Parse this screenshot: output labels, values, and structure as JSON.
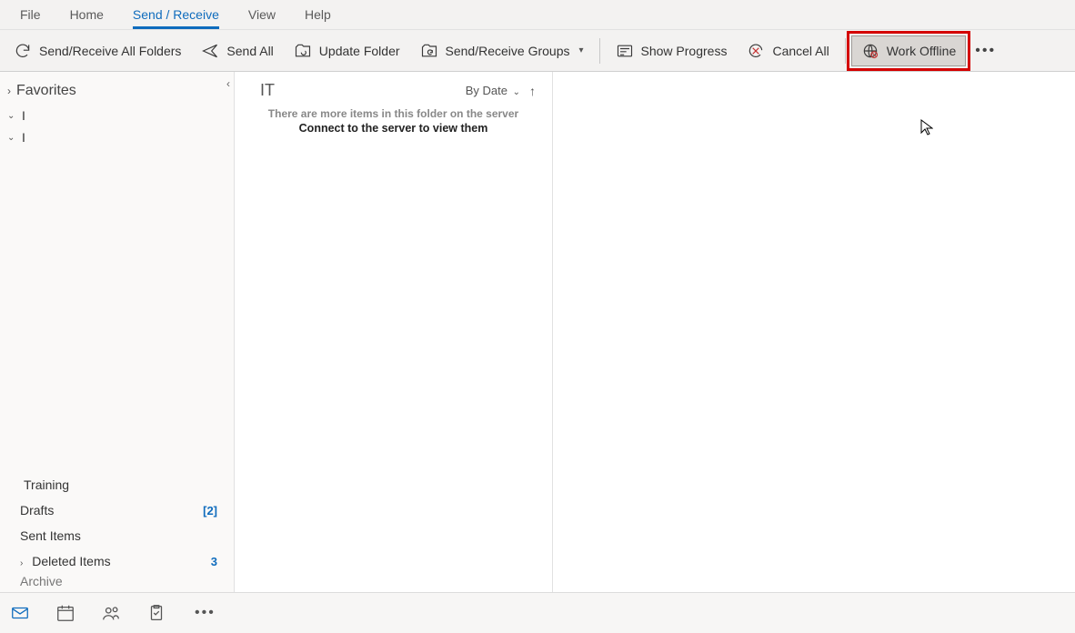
{
  "tabs": {
    "file": "File",
    "home": "Home",
    "send_receive": "Send / Receive",
    "view": "View",
    "help": "Help"
  },
  "toolbar": {
    "send_receive_all": "Send/Receive All Folders",
    "send_all": "Send All",
    "update_folder": "Update Folder",
    "send_receive_groups": "Send/Receive Groups",
    "show_progress": "Show Progress",
    "cancel_all": "Cancel All",
    "work_offline": "Work Offline"
  },
  "folder_pane": {
    "favorites": "Favorites",
    "group1": "I",
    "group2": "I",
    "training": "Training",
    "drafts": {
      "label": "Drafts",
      "count": "[2]"
    },
    "sent": {
      "label": "Sent Items"
    },
    "deleted": {
      "label": "Deleted Items",
      "count": "3"
    },
    "archive": {
      "label": "Archive"
    }
  },
  "message_list": {
    "header": "IT",
    "sort_label": "By Date",
    "empty_line1": "There are more items in this folder on the server",
    "empty_line2": "Connect to the server to view them"
  }
}
